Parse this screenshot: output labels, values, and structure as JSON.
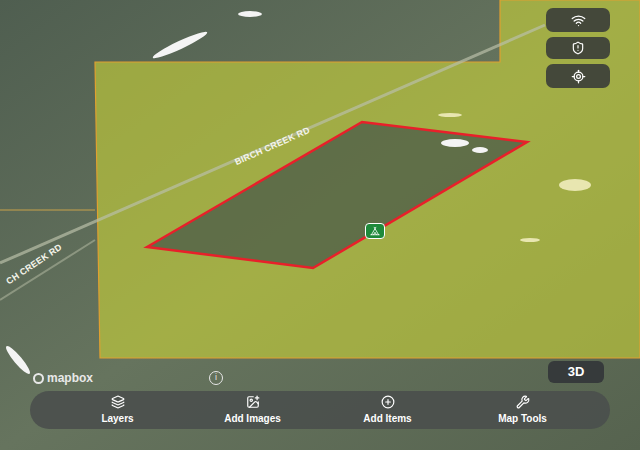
{
  "map": {
    "road_labels": [
      {
        "text": "BIRCH CREEK RD"
      },
      {
        "text": "CH CREEK RD"
      }
    ],
    "attribution": {
      "logo": "mapbox",
      "info": "i"
    }
  },
  "controls": {
    "view_toggle": "3D"
  },
  "toolbar": [
    {
      "label": "Layers"
    },
    {
      "label": "Add Images"
    },
    {
      "label": "Add Items"
    },
    {
      "label": "Map Tools"
    }
  ]
}
